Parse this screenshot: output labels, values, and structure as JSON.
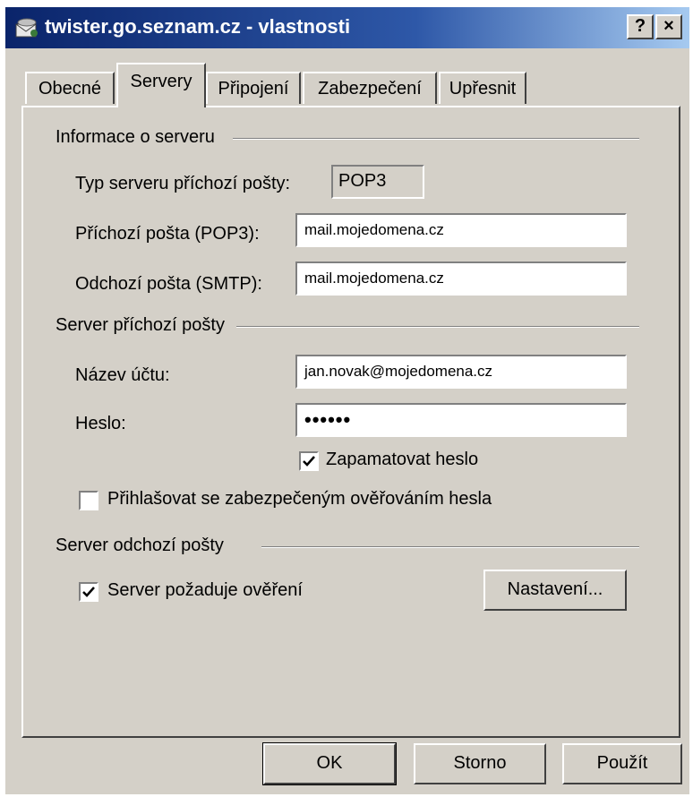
{
  "window": {
    "title": "twister.go.seznam.cz - vlastnosti",
    "help_button": "?",
    "close_button": "×"
  },
  "tabs": [
    {
      "label": "Obecné",
      "active": false
    },
    {
      "label": "Servery",
      "active": true
    },
    {
      "label": "Připojení",
      "active": false
    },
    {
      "label": "Zabezpečení",
      "active": false
    },
    {
      "label": "Upřesnit",
      "active": false
    }
  ],
  "server_info": {
    "group_label": "Informace o serveru",
    "server_type_label": "Typ serveru příchozí pošty:",
    "server_type_value": "POP3",
    "incoming_label": "Příchozí pošta (POP3):",
    "incoming_value": "mail.mojedomena.cz",
    "outgoing_label": "Odchozí pošta (SMTP):",
    "outgoing_value": "mail.mojedomena.cz"
  },
  "incoming_server": {
    "group_label": "Server příchozí pošty",
    "account_label": "Název účtu:",
    "account_value": "jan.novak@mojedomena.cz",
    "password_label": "Heslo:",
    "password_value": "••••••",
    "remember_label": "Zapamatovat heslo",
    "remember_checked": true,
    "spa_label": "Přihlašovat se zabezpečeným ověřováním hesla",
    "spa_checked": false
  },
  "outgoing_server": {
    "group_label": "Server odchozí pošty",
    "auth_label": "Server požaduje ověření",
    "auth_checked": true,
    "settings_button": "Nastavení..."
  },
  "buttons": {
    "ok": "OK",
    "cancel": "Storno",
    "apply": "Použít"
  },
  "colors": {
    "title_bar_start": "#0a246a",
    "title_bar_end": "#a6caf0",
    "dialog_face": "#d4d0c8"
  }
}
